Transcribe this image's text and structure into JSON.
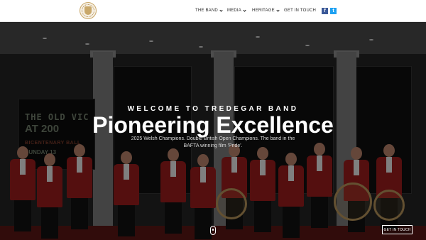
{
  "header": {
    "logo_icon": "tredegar-band-crest",
    "nav": [
      {
        "label": "THE BAND",
        "has_dropdown": true
      },
      {
        "label": "MEDIA",
        "has_dropdown": true
      },
      {
        "label": "HERITAGE",
        "has_dropdown": true
      },
      {
        "label": "GET IN TOUCH",
        "has_dropdown": false
      }
    ],
    "social": {
      "facebook_glyph": "f",
      "twitter_glyph": "t"
    }
  },
  "hero": {
    "welcome": "WELCOME TO TREDEGAR BAND",
    "headline": "Pioneering Excellence",
    "subtext": "2025 Welsh Champions. Double British Open Champions. The band in the BAFTA winning film 'Pride'.",
    "sign": {
      "line1": "THE OLD VIC",
      "line2": "AT 200",
      "line3": "BICENTENARY BALL",
      "line4": "SUNDAY 13"
    },
    "cta_label": "GET IN TOUCH",
    "scroll_icon": "mouse-scroll-icon"
  },
  "colors": {
    "header_bg": "#ffffff",
    "nav_text": "#2b2b2b",
    "facebook": "#3b5998",
    "twitter": "#1da1f2",
    "jacket_red": "#9a1d1d",
    "brass_gold": "#b4935a"
  }
}
